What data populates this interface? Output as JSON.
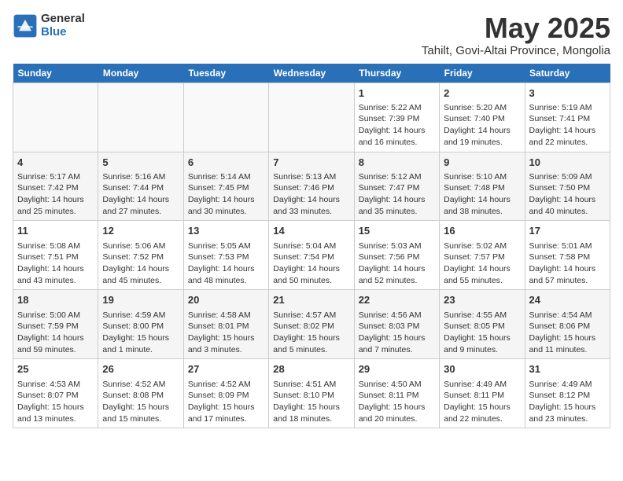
{
  "header": {
    "logo_general": "General",
    "logo_blue": "Blue",
    "title": "May 2025",
    "subtitle": "Tahilt, Govi-Altai Province, Mongolia"
  },
  "days_of_week": [
    "Sunday",
    "Monday",
    "Tuesday",
    "Wednesday",
    "Thursday",
    "Friday",
    "Saturday"
  ],
  "weeks": [
    {
      "days": [
        {
          "number": "",
          "info": ""
        },
        {
          "number": "",
          "info": ""
        },
        {
          "number": "",
          "info": ""
        },
        {
          "number": "",
          "info": ""
        },
        {
          "number": "1",
          "info": "Sunrise: 5:22 AM\nSunset: 7:39 PM\nDaylight: 14 hours\nand 16 minutes."
        },
        {
          "number": "2",
          "info": "Sunrise: 5:20 AM\nSunset: 7:40 PM\nDaylight: 14 hours\nand 19 minutes."
        },
        {
          "number": "3",
          "info": "Sunrise: 5:19 AM\nSunset: 7:41 PM\nDaylight: 14 hours\nand 22 minutes."
        }
      ]
    },
    {
      "days": [
        {
          "number": "4",
          "info": "Sunrise: 5:17 AM\nSunset: 7:42 PM\nDaylight: 14 hours\nand 25 minutes."
        },
        {
          "number": "5",
          "info": "Sunrise: 5:16 AM\nSunset: 7:44 PM\nDaylight: 14 hours\nand 27 minutes."
        },
        {
          "number": "6",
          "info": "Sunrise: 5:14 AM\nSunset: 7:45 PM\nDaylight: 14 hours\nand 30 minutes."
        },
        {
          "number": "7",
          "info": "Sunrise: 5:13 AM\nSunset: 7:46 PM\nDaylight: 14 hours\nand 33 minutes."
        },
        {
          "number": "8",
          "info": "Sunrise: 5:12 AM\nSunset: 7:47 PM\nDaylight: 14 hours\nand 35 minutes."
        },
        {
          "number": "9",
          "info": "Sunrise: 5:10 AM\nSunset: 7:48 PM\nDaylight: 14 hours\nand 38 minutes."
        },
        {
          "number": "10",
          "info": "Sunrise: 5:09 AM\nSunset: 7:50 PM\nDaylight: 14 hours\nand 40 minutes."
        }
      ]
    },
    {
      "days": [
        {
          "number": "11",
          "info": "Sunrise: 5:08 AM\nSunset: 7:51 PM\nDaylight: 14 hours\nand 43 minutes."
        },
        {
          "number": "12",
          "info": "Sunrise: 5:06 AM\nSunset: 7:52 PM\nDaylight: 14 hours\nand 45 minutes."
        },
        {
          "number": "13",
          "info": "Sunrise: 5:05 AM\nSunset: 7:53 PM\nDaylight: 14 hours\nand 48 minutes."
        },
        {
          "number": "14",
          "info": "Sunrise: 5:04 AM\nSunset: 7:54 PM\nDaylight: 14 hours\nand 50 minutes."
        },
        {
          "number": "15",
          "info": "Sunrise: 5:03 AM\nSunset: 7:56 PM\nDaylight: 14 hours\nand 52 minutes."
        },
        {
          "number": "16",
          "info": "Sunrise: 5:02 AM\nSunset: 7:57 PM\nDaylight: 14 hours\nand 55 minutes."
        },
        {
          "number": "17",
          "info": "Sunrise: 5:01 AM\nSunset: 7:58 PM\nDaylight: 14 hours\nand 57 minutes."
        }
      ]
    },
    {
      "days": [
        {
          "number": "18",
          "info": "Sunrise: 5:00 AM\nSunset: 7:59 PM\nDaylight: 14 hours\nand 59 minutes."
        },
        {
          "number": "19",
          "info": "Sunrise: 4:59 AM\nSunset: 8:00 PM\nDaylight: 15 hours\nand 1 minute."
        },
        {
          "number": "20",
          "info": "Sunrise: 4:58 AM\nSunset: 8:01 PM\nDaylight: 15 hours\nand 3 minutes."
        },
        {
          "number": "21",
          "info": "Sunrise: 4:57 AM\nSunset: 8:02 PM\nDaylight: 15 hours\nand 5 minutes."
        },
        {
          "number": "22",
          "info": "Sunrise: 4:56 AM\nSunset: 8:03 PM\nDaylight: 15 hours\nand 7 minutes."
        },
        {
          "number": "23",
          "info": "Sunrise: 4:55 AM\nSunset: 8:05 PM\nDaylight: 15 hours\nand 9 minutes."
        },
        {
          "number": "24",
          "info": "Sunrise: 4:54 AM\nSunset: 8:06 PM\nDaylight: 15 hours\nand 11 minutes."
        }
      ]
    },
    {
      "days": [
        {
          "number": "25",
          "info": "Sunrise: 4:53 AM\nSunset: 8:07 PM\nDaylight: 15 hours\nand 13 minutes."
        },
        {
          "number": "26",
          "info": "Sunrise: 4:52 AM\nSunset: 8:08 PM\nDaylight: 15 hours\nand 15 minutes."
        },
        {
          "number": "27",
          "info": "Sunrise: 4:52 AM\nSunset: 8:09 PM\nDaylight: 15 hours\nand 17 minutes."
        },
        {
          "number": "28",
          "info": "Sunrise: 4:51 AM\nSunset: 8:10 PM\nDaylight: 15 hours\nand 18 minutes."
        },
        {
          "number": "29",
          "info": "Sunrise: 4:50 AM\nSunset: 8:11 PM\nDaylight: 15 hours\nand 20 minutes."
        },
        {
          "number": "30",
          "info": "Sunrise: 4:49 AM\nSunset: 8:11 PM\nDaylight: 15 hours\nand 22 minutes."
        },
        {
          "number": "31",
          "info": "Sunrise: 4:49 AM\nSunset: 8:12 PM\nDaylight: 15 hours\nand 23 minutes."
        }
      ]
    }
  ]
}
